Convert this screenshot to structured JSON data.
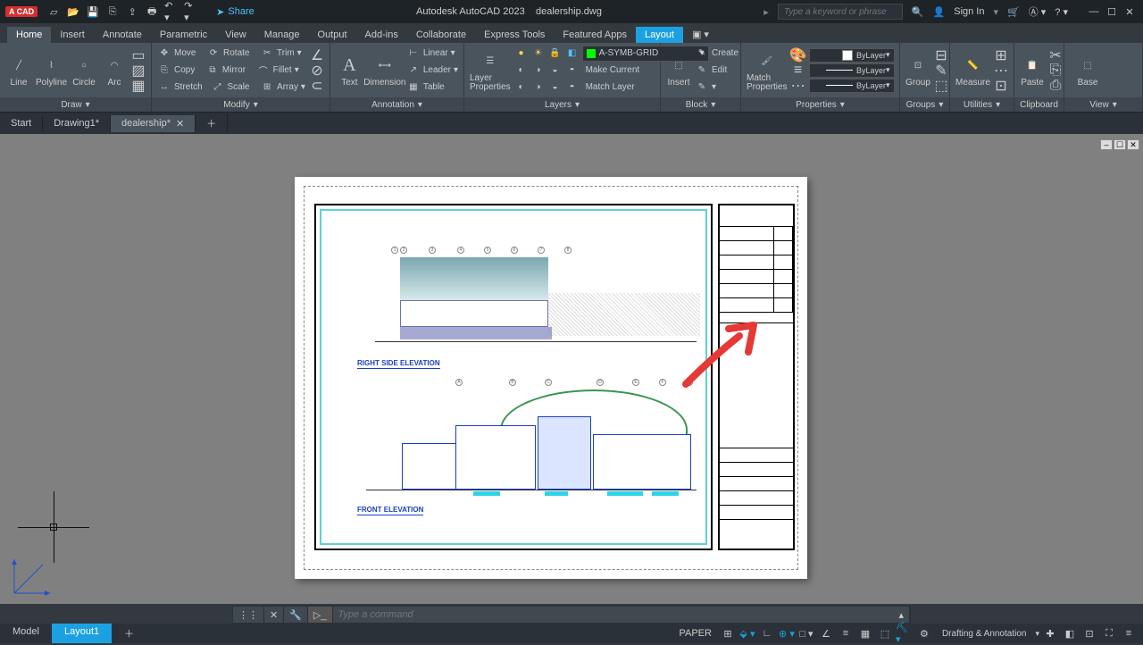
{
  "app": {
    "title": "Autodesk AutoCAD 2023",
    "filename": "dealership.dwg",
    "badge": "A CAD"
  },
  "qat": [
    "new",
    "open",
    "save",
    "saveas",
    "plot",
    "undo",
    "redo"
  ],
  "share": "Share",
  "search": {
    "placeholder": "Type a keyword or phrase"
  },
  "signin": "Sign In",
  "menus": [
    "Home",
    "Insert",
    "Annotate",
    "Parametric",
    "View",
    "Manage",
    "Output",
    "Add-ins",
    "Collaborate",
    "Express Tools",
    "Featured Apps",
    "Layout"
  ],
  "active_menus": {
    "home": "Home",
    "layout": "Layout"
  },
  "ribbon": {
    "draw": {
      "label": "Draw",
      "items": [
        "Line",
        "Polyline",
        "Circle",
        "Arc"
      ]
    },
    "modify": {
      "label": "Modify",
      "rows": [
        [
          "Move",
          "Rotate",
          "Trim"
        ],
        [
          "Copy",
          "Mirror",
          "Fillet"
        ],
        [
          "Stretch",
          "Scale",
          "Array"
        ]
      ]
    },
    "annotation": {
      "label": "Annotation",
      "text": "Text",
      "dim": "Dimension",
      "items": [
        "Linear",
        "Leader",
        "Table"
      ]
    },
    "layers": {
      "label": "Layers",
      "props": "Layer Properties",
      "current": "A-SYMB-GRID",
      "items": [
        "Make Current",
        "Match Layer"
      ]
    },
    "block": {
      "label": "Block",
      "insert": "Insert",
      "items": [
        "Create",
        "Edit"
      ]
    },
    "properties": {
      "label": "Properties",
      "match": "Match Properties",
      "combos": [
        "ByLayer",
        "ByLayer",
        "ByLayer"
      ]
    },
    "groups": {
      "label": "Groups",
      "item": "Group"
    },
    "utilities": {
      "label": "Utilities",
      "item": "Measure"
    },
    "clipboard": {
      "label": "Clipboard",
      "item": "Paste"
    },
    "view": {
      "label": "View",
      "item": "Base"
    }
  },
  "filetabs": [
    "Start",
    "Drawing1*",
    "dealership*"
  ],
  "drawing": {
    "title1": "RIGHT SIDE ELEVATION",
    "title2": "FRONT ELEVATION"
  },
  "cmd": {
    "placeholder": "Type a command"
  },
  "layout_tabs": [
    "Model",
    "Layout1"
  ],
  "status": {
    "space": "PAPER",
    "workspace": "Drafting & Annotation"
  }
}
